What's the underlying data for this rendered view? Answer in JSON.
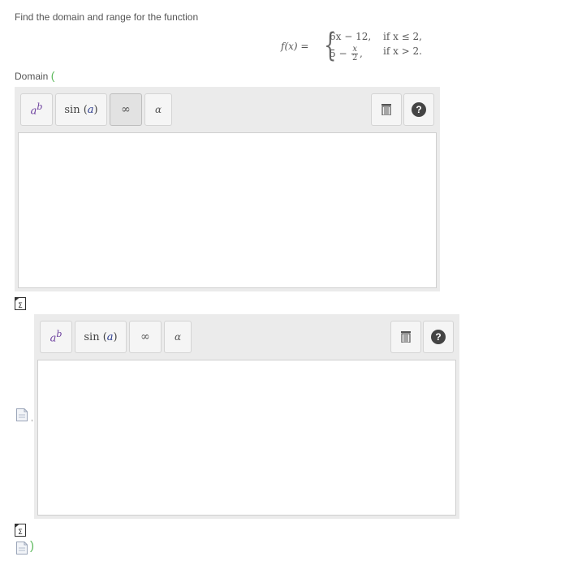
{
  "prompt": "Find the domain and range for the function",
  "math": {
    "lhs": "f(x) =",
    "case1_expr": "6x − 12,",
    "case1_cond": "if x ≤ 2,",
    "case2_prefix": "5 −",
    "case2_frac_num": "x",
    "case2_frac_den": "2",
    "case2_suffix": ",",
    "case2_cond": "if x > 2."
  },
  "domain": {
    "label": "Domain",
    "open_paren": "(",
    "separator": ",",
    "close_paren": ")"
  },
  "toolbar": {
    "power_base": "a",
    "power_exp": "b",
    "sin_fn": "sin",
    "sin_arg": "a",
    "infinity": "∞",
    "alpha": "α",
    "help": "?"
  },
  "colors": {
    "accent_green": "#5cb85c",
    "toolbar_bg": "#ebebeb",
    "help_bg": "#444444"
  }
}
